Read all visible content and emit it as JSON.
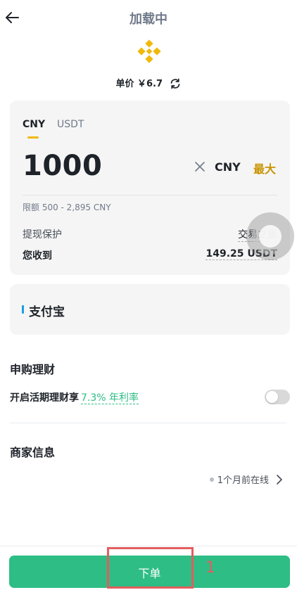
{
  "header": {
    "title": "加载中"
  },
  "price": {
    "label": "单价",
    "value": "￥6.7"
  },
  "currency_tabs": [
    {
      "label": "CNY"
    },
    {
      "label": "USDT"
    }
  ],
  "amount": {
    "value": "1000",
    "unit": "CNY",
    "max_label": "最大"
  },
  "limit_text": "限额 500 - 2,895 CNY",
  "protection": {
    "label": "提现保护",
    "value": "交易之星"
  },
  "receive": {
    "label": "您收到",
    "value": "149.25 USDT"
  },
  "payment": {
    "method": "支付宝"
  },
  "earn": {
    "section_title": "申购理财",
    "text": "开启活期理财享",
    "rate": "7.3% 年利率",
    "enabled": false
  },
  "merchant": {
    "section_title": "商家信息",
    "online_status": "1个月前在线"
  },
  "order_button": {
    "label": "下单"
  },
  "annotation": {
    "step": "1"
  },
  "colors": {
    "brand_yellow": "#F0B90B",
    "primary_green": "#2EBD85",
    "highlight_red": "#E35D5D",
    "alipay_blue": "#1E9BE6"
  },
  "icons": [
    "back-arrow-icon",
    "binance-logo-icon",
    "refresh-icon",
    "clear-icon",
    "chevron-right-icon"
  ]
}
